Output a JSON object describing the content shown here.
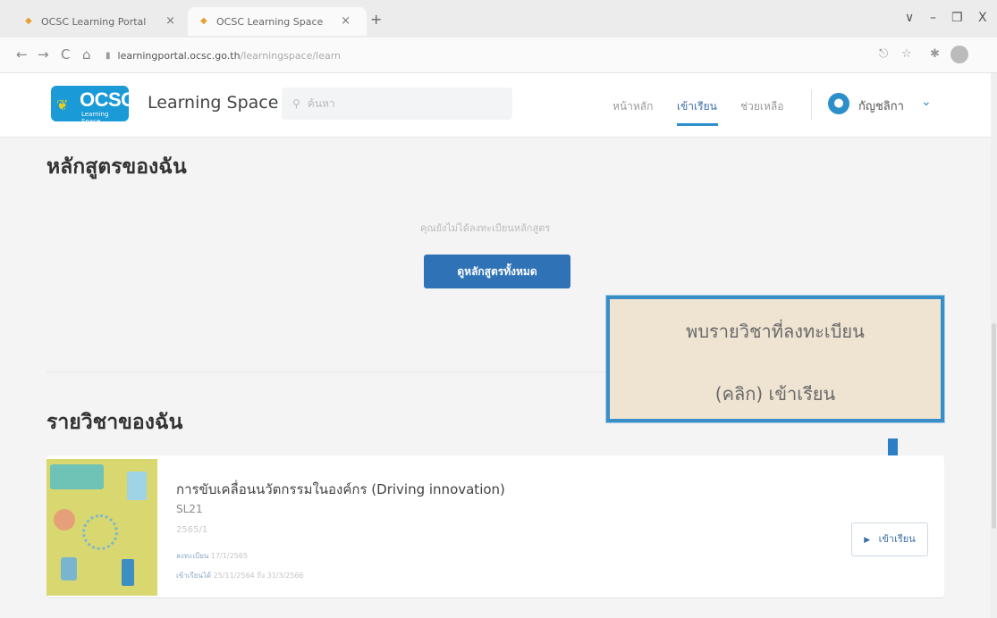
{
  "browser": {
    "tabs": [
      {
        "title": "OCSC Learning Portal",
        "close": "×"
      },
      {
        "title": "OCSC Learning Space",
        "close": "×"
      }
    ],
    "new_tab": "+",
    "window_controls": {
      "dropdown": "∨",
      "minimize": "–",
      "restore": "❐",
      "close": "X"
    },
    "nav": {
      "back": "←",
      "forward": "→",
      "reload": "C",
      "home": "⌂"
    },
    "url": {
      "host": "learningportal.ocsc.go.th",
      "path": "/learningspace/learn"
    },
    "right_icons": {
      "share": "⎋",
      "star": "☆",
      "extensions": "✱"
    }
  },
  "header": {
    "logo": {
      "brand": "OCSC",
      "subtitle": "Learning Space",
      "leaf": "❦"
    },
    "site_title": "Learning Space",
    "search": {
      "icon": "⚲",
      "placeholder": "ค้นหา"
    },
    "nav": [
      {
        "label": "หน้าหลัก",
        "active": false
      },
      {
        "label": "เข้าเรียน",
        "active": true
      },
      {
        "label": "ช่วยเหลือ",
        "active": false
      }
    ],
    "user": {
      "name": "กัญชลิกา",
      "icon": "●",
      "chevron": "⌄"
    }
  },
  "my_courses": {
    "heading": "หลักสูตรของฉัน",
    "empty_message": "คุณยังไม่ได้ลงทะเบียนหลักสูตร",
    "view_all_button": "ดูหลักสูตรทั้งหมด"
  },
  "callout": {
    "line1": "พบรายวิชาที่ลงทะเบียน",
    "line2": "(คลิก) เข้าเรียน",
    "border_color": "#3a8ec8"
  },
  "my_subjects": {
    "heading": "รายวิชาของฉัน",
    "items": [
      {
        "title": "การขับเคลื่อนนวัตกรรมในองค์กร (Driving innovation)",
        "code": "SL21",
        "term": "2565/1",
        "registered_label": "ลงทะเบียน",
        "registered_date": "17/1/2565",
        "available_label": "เข้าเรียนได้",
        "available_range": "25/11/2564 ถึง 31/3/2566",
        "button": {
          "icon": "▶",
          "label": "เข้าเรียน"
        }
      }
    ]
  },
  "colors": {
    "primary": "#2f73b6",
    "accent": "#2c8fc9"
  }
}
